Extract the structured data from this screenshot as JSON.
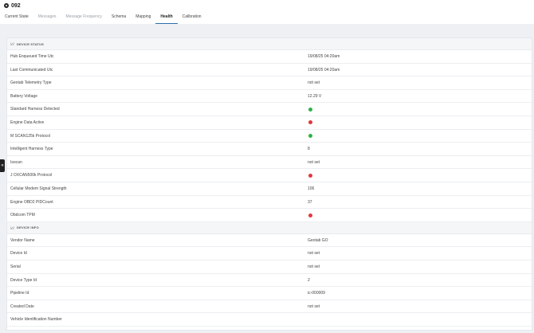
{
  "header": {
    "title": "092",
    "device_icon": "device-icon"
  },
  "tabs": [
    {
      "label": "Current State",
      "state": "normal"
    },
    {
      "label": "Messages",
      "state": "disabled"
    },
    {
      "label": "Message Frequency",
      "state": "disabled"
    },
    {
      "label": "Schema",
      "state": "normal"
    },
    {
      "label": "Mapping",
      "state": "normal"
    },
    {
      "label": "Health",
      "state": "active"
    },
    {
      "label": "Calibration",
      "state": "normal"
    }
  ],
  "colors": {
    "accent": "#2a6fb0",
    "status_green": "#2eb24b",
    "status_red": "#e0383e"
  },
  "device_status": {
    "title": "DEVICE STATUS",
    "rows": [
      {
        "key": "Hub Enqueued Time Utc",
        "value": "19/08/25 04:20am"
      },
      {
        "key": "Last Communicated Utc",
        "value": "19/08/25 04:20am"
      },
      {
        "key": "Geotab Telemetry Type",
        "value": "not set"
      },
      {
        "key": "Battery Voltage",
        "value": "12.29 V"
      },
      {
        "key": "Standard Harness Detected",
        "status": "green"
      },
      {
        "key": "Engine Data Active",
        "status": "red"
      },
      {
        "key": "M SCAN125k Protocol",
        "status": "green"
      },
      {
        "key": "Intelligent Harness Type",
        "value": "8"
      },
      {
        "key": "Isocan",
        "value": "not set"
      },
      {
        "key": "J OXCAN500k Protocol",
        "status": "red"
      },
      {
        "key": "Cellular Modem Signal Strength",
        "value": "106"
      },
      {
        "key": "Engine OBD2 PIDCount",
        "value": "37"
      },
      {
        "key": "Obdcom TPM",
        "status": "red"
      }
    ]
  },
  "device_info": {
    "title": "DEVICE INFO",
    "rows": [
      {
        "key": "Vendor Name",
        "value": "Geotab GO"
      },
      {
        "key": "Device Id",
        "value": "not set"
      },
      {
        "key": "Serial",
        "value": "not set"
      },
      {
        "key": "Device Type Id",
        "value": "2"
      },
      {
        "key": "Pipeline Id",
        "value": "ic-000009"
      },
      {
        "key": "Created Date",
        "value": "not set"
      },
      {
        "key": "Vehicle Identification Number",
        "value": ""
      }
    ]
  }
}
